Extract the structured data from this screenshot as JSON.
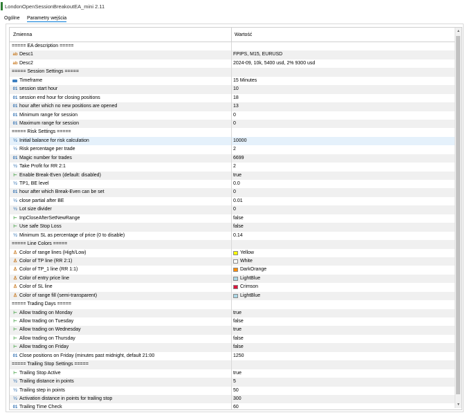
{
  "window": {
    "title": "LondonOpenSessionBreakoutEA_mini 2.11"
  },
  "tabs": [
    {
      "label": "Ogólne",
      "active": false
    },
    {
      "label": "Parametry wejścia",
      "active": true
    }
  ],
  "table": {
    "columns": [
      "Zmienna",
      "Wartość"
    ],
    "rows": [
      {
        "icon": "none",
        "name": "===== EA description =====",
        "value": ""
      },
      {
        "icon": "string",
        "name": "Desc1",
        "value": "FPIPS, M15, EURUSD"
      },
      {
        "icon": "string",
        "name": "Desc2",
        "value": "2024-09, 10k, 5400 usd, 2% 9300 usd"
      },
      {
        "icon": "none",
        "name": "===== Session Settings =====",
        "value": ""
      },
      {
        "icon": "enum",
        "name": "Timeframe",
        "value": "15 Minutes"
      },
      {
        "icon": "int",
        "name": "session start hour",
        "value": "10"
      },
      {
        "icon": "int",
        "name": "session end hour  for closing positions",
        "value": "18"
      },
      {
        "icon": "int",
        "name": "hour after which no new positions are opened",
        "value": "13"
      },
      {
        "icon": "int",
        "name": "Minimum range for session",
        "value": "0"
      },
      {
        "icon": "int",
        "name": "Maximum range for session",
        "value": "0"
      },
      {
        "icon": "none",
        "name": "===== Risk Settings =====",
        "value": ""
      },
      {
        "icon": "double",
        "name": "Initial balance for risk calculation",
        "value": "10000",
        "selected": true
      },
      {
        "icon": "double",
        "name": "Risk percentage per trade",
        "value": "2"
      },
      {
        "icon": "int",
        "name": "Magic number for trades",
        "value": "6699"
      },
      {
        "icon": "double",
        "name": "Take Profit for RR 2:1",
        "value": "2"
      },
      {
        "icon": "bool",
        "name": "Enable Break-Even (default: disabled)",
        "value": "true"
      },
      {
        "icon": "double",
        "name": "TP1, BE level",
        "value": "0.0"
      },
      {
        "icon": "int",
        "name": "hour after which Break-Even can be set",
        "value": "0"
      },
      {
        "icon": "double",
        "name": "close partial after BE",
        "value": "0.01"
      },
      {
        "icon": "double",
        "name": "Lot size divider",
        "value": "0"
      },
      {
        "icon": "bool",
        "name": "InpCloseAfterSetNewRange",
        "value": "false"
      },
      {
        "icon": "bool",
        "name": "Use safe Stop Loss",
        "value": "false"
      },
      {
        "icon": "double",
        "name": "Minimum SL as percentage of price (0 to disable)",
        "value": "0.14"
      },
      {
        "icon": "none",
        "name": "===== Line Colors =====",
        "value": ""
      },
      {
        "icon": "color",
        "name": "Color of range lines (High/Low)",
        "value": "Yellow",
        "swatch": "#ffff00"
      },
      {
        "icon": "color",
        "name": "Color of TP line (RR 2:1)",
        "value": "White",
        "swatch": "#ffffff"
      },
      {
        "icon": "color",
        "name": "Color of TP_1 line (RR 1:1)",
        "value": "DarkOrange",
        "swatch": "#ff8c00"
      },
      {
        "icon": "color",
        "name": "Color of entry price line",
        "value": "LightBlue",
        "swatch": "#add8e6"
      },
      {
        "icon": "color",
        "name": "Color of SL line",
        "value": "Crimson",
        "swatch": "#dc143c"
      },
      {
        "icon": "color",
        "name": "Color of range fill (semi-transparent)",
        "value": "LightBlue",
        "swatch": "#add8e6"
      },
      {
        "icon": "none",
        "name": "===== Trading Days =====",
        "value": ""
      },
      {
        "icon": "bool",
        "name": "Allow trading on Monday",
        "value": "true"
      },
      {
        "icon": "bool",
        "name": "Allow trading on Tuesday",
        "value": "false"
      },
      {
        "icon": "bool",
        "name": "Allow trading on Wednesday",
        "value": "true"
      },
      {
        "icon": "bool",
        "name": "Allow trading on Thursday",
        "value": "false"
      },
      {
        "icon": "bool",
        "name": "Allow trading on Friday",
        "value": "false"
      },
      {
        "icon": "int",
        "name": "Close positions on Friday (minutes past midnight, default 21:00",
        "value": "1250"
      },
      {
        "icon": "none",
        "name": "===== Trailing Stop Settings =====",
        "value": ""
      },
      {
        "icon": "bool",
        "name": "Trailing Stop Active",
        "value": "true"
      },
      {
        "icon": "double",
        "name": "Trailing distance in points",
        "value": "5"
      },
      {
        "icon": "double",
        "name": "Trailing step in points",
        "value": "50"
      },
      {
        "icon": "double",
        "name": "Activation distance in points for trailing stop",
        "value": "300"
      },
      {
        "icon": "int",
        "name": "Trailing Time Check",
        "value": "60"
      }
    ]
  },
  "icon_glyphs": {
    "string": "ab",
    "int": "01",
    "double": "½",
    "bool": "⊢",
    "color": "♙",
    "enum": "",
    "none": ""
  }
}
